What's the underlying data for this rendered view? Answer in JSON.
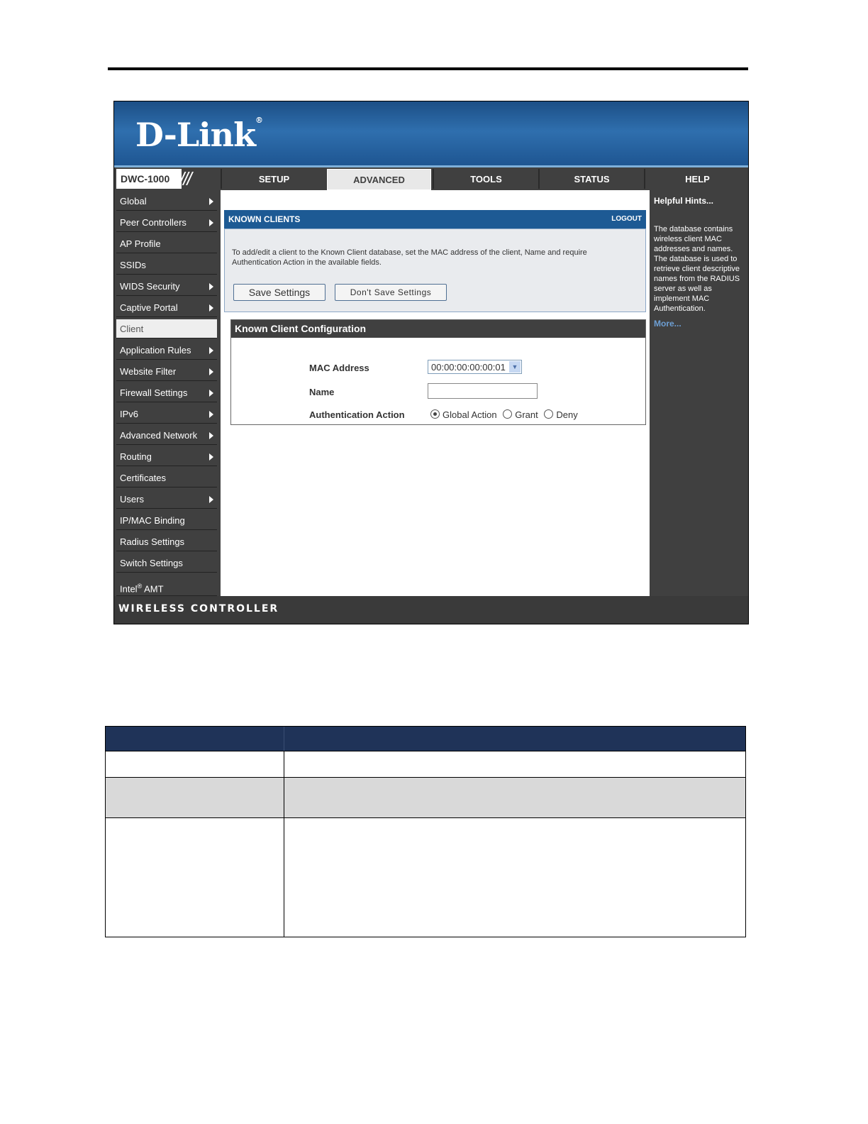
{
  "brand": {
    "logo_text": "D-Link",
    "model": "DWC-1000",
    "footer": "WIRELESS CONTROLLER"
  },
  "tabs": [
    {
      "label": "SETUP"
    },
    {
      "label": "ADVANCED"
    },
    {
      "label": "TOOLS"
    },
    {
      "label": "STATUS"
    },
    {
      "label": "HELP"
    }
  ],
  "sidebar": {
    "items": [
      {
        "label": "Global"
      },
      {
        "label": "Peer Controllers"
      },
      {
        "label": "AP Profile"
      },
      {
        "label": "SSIDs"
      },
      {
        "label": "WIDS Security"
      },
      {
        "label": "Captive Portal"
      },
      {
        "label": "Client"
      },
      {
        "label": "Application Rules"
      },
      {
        "label": "Website Filter"
      },
      {
        "label": "Firewall Settings"
      },
      {
        "label": "IPv6"
      },
      {
        "label": "Advanced Network"
      },
      {
        "label": "Routing"
      },
      {
        "label": "Certificates"
      },
      {
        "label": "Users"
      },
      {
        "label": "IP/MAC Binding"
      },
      {
        "label": "Radius Settings"
      },
      {
        "label": "Switch Settings"
      },
      {
        "label": "Intel",
        "superscript": "®",
        "suffix": " AMT"
      }
    ],
    "selected": "Client"
  },
  "known_clients": {
    "title": "KNOWN CLIENTS",
    "logout": "LOGOUT",
    "intro": "To add/edit a client to the Known Client database, set the MAC address of the client, Name and require Authentication Action in the available fields.",
    "save_label": "Save Settings",
    "dont_save_label": "Don't Save Settings"
  },
  "config": {
    "title": "Known Client Configuration",
    "mac_label": "MAC Address",
    "mac_value": "00:00:00:00:00:01",
    "name_label": "Name",
    "name_value": "",
    "auth_label": "Authentication Action",
    "auth_options": [
      "Global Action",
      "Grant",
      "Deny"
    ],
    "auth_selected": "Global Action"
  },
  "help": {
    "title": "Helpful Hints...",
    "text": "The database contains wireless client MAC addresses and names. The database is used to retrieve client descriptive names from the RADIUS server as well as implement MAC Authentication.",
    "more": "More..."
  },
  "colors": {
    "banner_blue": "#2f6fae",
    "panel_header_blue": "#1d5a94",
    "dark_gray": "#404040",
    "table_header_navy": "#1f3358",
    "table_row_gray": "#d9d9d9"
  }
}
